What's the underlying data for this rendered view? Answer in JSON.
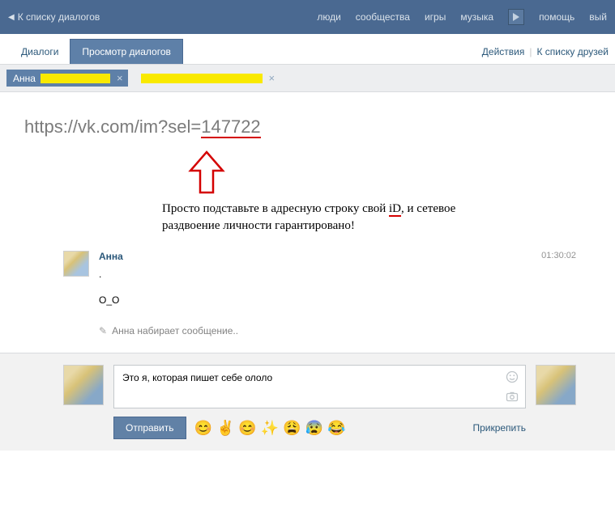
{
  "topbar": {
    "back": "К списку диалогов",
    "nav": {
      "people": "люди",
      "communities": "сообщества",
      "games": "игры",
      "music": "музыка",
      "help": "помощь",
      "logout": "вый"
    }
  },
  "tabs": {
    "dialogs": "Диалоги",
    "view": "Просмотр диалогов",
    "actions": "Действия",
    "friends": "К списку друзей"
  },
  "conversations": {
    "active_name": "Анна"
  },
  "annotation": {
    "url_prefix": "https://vk.com/im?sel=",
    "url_id": "147722",
    "text_pre": "Просто подставьте в адресную строку свой ",
    "text_id": "iD",
    "text_post": ", и сетевое раздвоение личности гарантировано!"
  },
  "message": {
    "author": "Анна",
    "time": "01:30:02",
    "line1": ".",
    "line2": "О_О",
    "typing": "Анна набирает сообщение.."
  },
  "composer": {
    "value": "Это я, которая пишет себе ололо",
    "send": "Отправить",
    "attach": "Прикрепить",
    "emojis": [
      "😊",
      "✌️",
      "😊",
      "✨",
      "😩",
      "😰",
      "😂"
    ]
  }
}
